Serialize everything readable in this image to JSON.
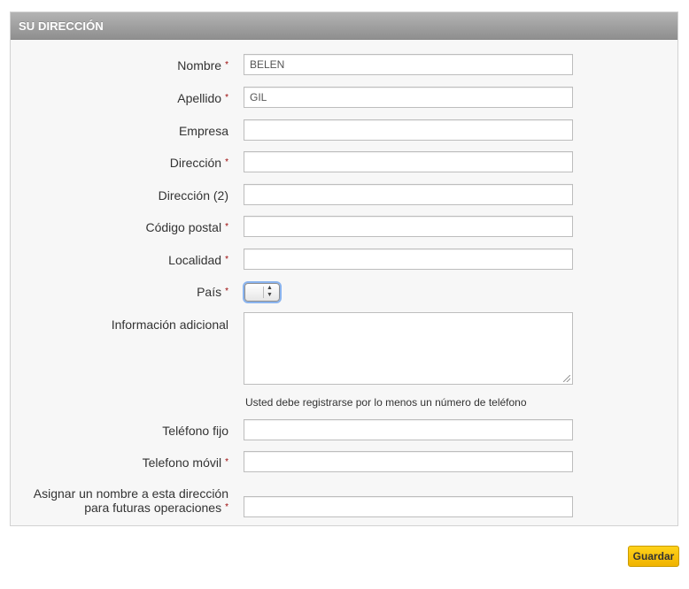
{
  "panel": {
    "title": "SU DIRECCIÓN"
  },
  "required_marker": "*",
  "fields": {
    "nombre": {
      "label": "Nombre",
      "value": "BELEN"
    },
    "apellido": {
      "label": "Apellido",
      "value": "GIL"
    },
    "empresa": {
      "label": "Empresa",
      "value": ""
    },
    "direccion": {
      "label": "Dirección",
      "value": ""
    },
    "direccion2": {
      "label": "Dirección (2)",
      "value": ""
    },
    "codigo_postal": {
      "label": "Código postal",
      "value": ""
    },
    "localidad": {
      "label": "Localidad",
      "value": ""
    },
    "pais": {
      "label": "País",
      "value": ""
    },
    "info_adicional": {
      "label": "Información adicional",
      "value": ""
    },
    "telefono_fijo": {
      "label": "Teléfono fijo",
      "value": ""
    },
    "telefono_movil": {
      "label": "Telefono móvil",
      "value": ""
    },
    "alias": {
      "label_line1": "Asignar un nombre a esta dirección",
      "label_line2": "para futuras operaciones",
      "value": ""
    }
  },
  "phone_note": "Usted debe registrarse por lo menos un número de teléfono",
  "actions": {
    "save_label": "Guardar"
  }
}
